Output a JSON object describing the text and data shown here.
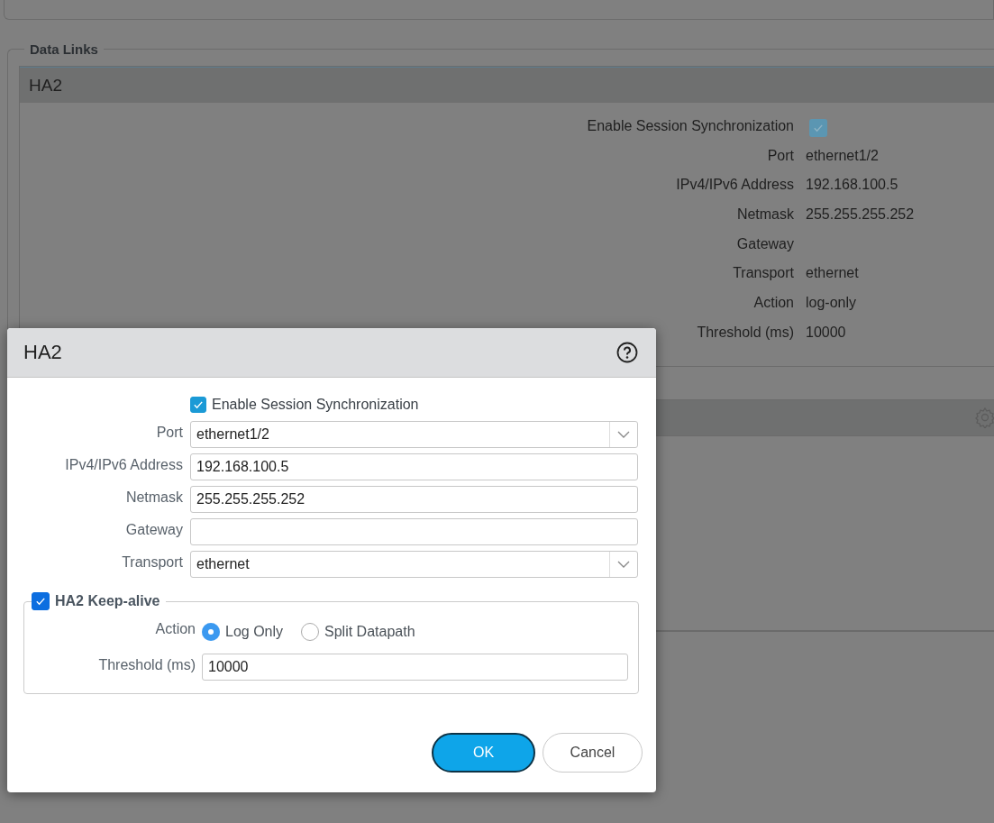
{
  "background": {
    "section_title": "Data Links",
    "panel": {
      "title": "HA2",
      "fields": [
        {
          "kind": "checkbox",
          "label": "Enable Session Synchronization",
          "checked": true
        },
        {
          "kind": "text",
          "label": "Port",
          "value": "ethernet1/2"
        },
        {
          "kind": "text",
          "label": "IPv4/IPv6 Address",
          "value": "192.168.100.5"
        },
        {
          "kind": "text",
          "label": "Netmask",
          "value": "255.255.255.252"
        },
        {
          "kind": "text",
          "label": "Gateway"
        },
        {
          "kind": "text",
          "label": "Transport",
          "value": "ethernet"
        },
        {
          "kind": "text",
          "label": "Action",
          "value": "log-only"
        },
        {
          "kind": "text",
          "label": "Threshold (ms)",
          "value": "10000"
        }
      ]
    }
  },
  "dialog": {
    "title": "HA2",
    "fields": [
      {
        "kind": "checkbox",
        "label": "Enable Session Synchronization",
        "checked": true
      },
      {
        "kind": "select",
        "label": "Port",
        "value": "ethernet1/2"
      },
      {
        "kind": "input",
        "label": "IPv4/IPv6 Address",
        "value": "192.168.100.5"
      },
      {
        "kind": "input",
        "label": "Netmask",
        "value": "255.255.255.252"
      },
      {
        "kind": "input",
        "label": "Gateway"
      },
      {
        "kind": "select",
        "label": "Transport",
        "value": "ethernet"
      }
    ],
    "keep_alive": {
      "label": "HA2 Keep-alive",
      "checked": true,
      "action": {
        "label": "Action",
        "options": [
          {
            "label": "Log Only",
            "selected": true
          },
          {
            "label": "Split Datapath",
            "selected": false
          }
        ]
      },
      "threshold": {
        "label": "Threshold (ms)",
        "value": "10000"
      }
    },
    "buttons": [
      {
        "kind": "primary",
        "label": "OK"
      },
      {
        "kind": "secondary",
        "label": "Cancel"
      }
    ]
  }
}
